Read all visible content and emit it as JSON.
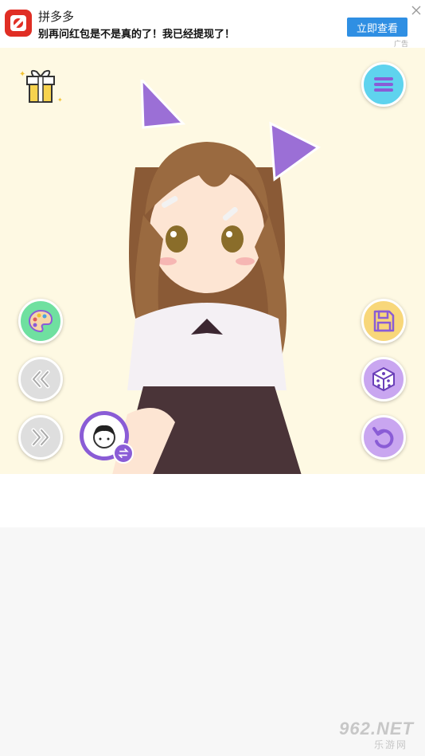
{
  "ad": {
    "brand": "拼多多",
    "headline": "别再问红包是不是真的了！我已经提现了！",
    "cta_label": "立即查看",
    "mark": "广告",
    "brand_color": "#e02e24",
    "cta_color": "#2f8fe3"
  },
  "stage": {
    "background": "#fef9e3",
    "buttons": [
      {
        "id": "gift",
        "icon": "gift-icon"
      },
      {
        "id": "menu",
        "icon": "menu-icon",
        "color": "#5fd3ee"
      },
      {
        "id": "palette",
        "icon": "palette-icon",
        "color": "#6fe0a0"
      },
      {
        "id": "prev",
        "icon": "double-chevron-left-icon",
        "color": "#dedede"
      },
      {
        "id": "next",
        "icon": "double-chevron-right-icon",
        "color": "#dedede"
      },
      {
        "id": "swap-character",
        "icon": "avatar-swap-icon",
        "color": "#8a5cd6"
      },
      {
        "id": "save",
        "icon": "floppy-disk-icon",
        "color": "#f8d77a"
      },
      {
        "id": "random",
        "icon": "dice-icon",
        "color": "#c9a6f0"
      },
      {
        "id": "undo",
        "icon": "undo-icon",
        "color": "#c9a6f0"
      }
    ]
  },
  "watermark": {
    "text": "962.NET",
    "sub": "乐游网"
  }
}
